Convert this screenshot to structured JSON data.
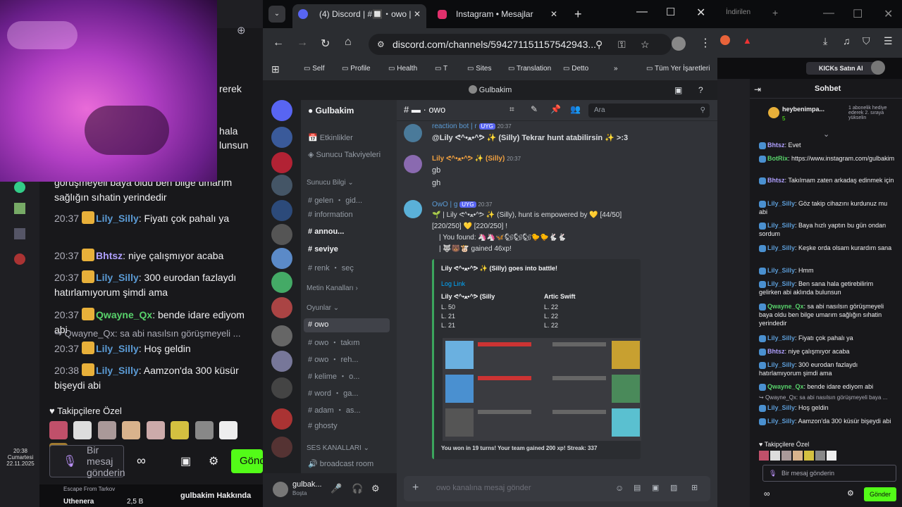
{
  "leftchat": {
    "partial1": "görüşmeyeli baya oldu ben bilge umarım sağlığın sıhatin yerindedir",
    "messages": [
      {
        "time": "20:37",
        "user": "Lily_Silly",
        "color": "#5b9bd5",
        "text": "Fiyatı çok pahalı ya"
      },
      {
        "time": "20:37",
        "user": "Bhtsz",
        "color": "#b0a0ff",
        "text": "niye çalışmıyor acaba"
      },
      {
        "time": "20:37",
        "user": "Lily_Silly",
        "color": "#5b9bd5",
        "text": "300 eurodan fazlaydı hatırlamıyorum şimdi ama"
      },
      {
        "time": "20:37",
        "user": "Qwayne_Qx",
        "color": "#58d26b",
        "text": "bende idare ediyom abi"
      },
      {
        "time": "20:37",
        "user": "Lily_Silly",
        "color": "#5b9bd5",
        "text": "Hoş geldin"
      },
      {
        "time": "20:38",
        "user": "Lily_Silly",
        "color": "#5b9bd5",
        "text": "Aamzon'da 300 küsür bişeydi abi"
      }
    ],
    "reply": "Qwayne_Qx: sa abi nasılsın görüşmeyeli ...",
    "followers": "Takipçilere Özel",
    "input_placeholder": "Bir mesaj gönderin",
    "send": "Gönd",
    "game": "Escape From Tarkov",
    "user": "Uthenera",
    "viewers": "2,5 B",
    "about": "gulbakim Hakkında",
    "clock_time": "20:38",
    "clock_day": "Cumartesi",
    "clock_date": "22.11.2025",
    "partial_left1": "rerek",
    "partial_left2": "hala",
    "partial_left3": "lunsun"
  },
  "browser": {
    "tab1": "(4) Discord | #🔲・owo | Gulbakim",
    "tab2": "Instagram • Mesajlar",
    "url": "discord.com/channels/594271151157542943...",
    "bookmarks": [
      "Self",
      "Profile",
      "Health",
      "T",
      "Sites",
      "Translation",
      "Detto",
      "Tüm Yer İşaretleri"
    ],
    "app_title": "Gulbakim"
  },
  "discord": {
    "server": "Gulbakim",
    "channel": "owo",
    "search": "Ara",
    "events": "Etkinlikler",
    "boosts": "Sunucu Takviyeleri",
    "cat_info": "Sunucu Bilgi",
    "ch_gelen": "gelen ・ gid...",
    "ch_information": "information",
    "ch_announ": "annou...",
    "ch_seviye": "seviye",
    "ch_renk": "renk ・ seç",
    "cat_text": "Metin Kanalları",
    "cat_games": "Oyunlar",
    "ch_owo": "owo",
    "ch_owo_takim": "owo ・ takım",
    "ch_owo_reh": "owo ・ reh...",
    "ch_kelime": "kelime ・ o...",
    "ch_word": "word ・ ga...",
    "ch_adam": "adam ・ as...",
    "ch_ghosty": "ghosty",
    "cat_voice": "SES KANALLARI",
    "ch_broadcast": "broadcast room",
    "me_name": "gulbak...",
    "me_status": "Boşta",
    "composer": "owo kanalına mesaj gönder",
    "msg1_user": "reaction bot | r",
    "msg1_tag": "UYG",
    "msg1_time": "20:37",
    "msg1_text": "@Lily ᕙ^•ﻌ•^ᕗ ✨ (Silly) Tekrar hunt atabilirsin ✨ >:3",
    "msg2_user": "Lily ᕙ^•ﻌ•^ᕗ ✨ (Silly)",
    "msg2_time": "20:37",
    "msg2_line1": "gb",
    "msg2_line2": "gh",
    "msg3_user": "OwO | g",
    "msg3_tag": "UYG",
    "msg3_time": "20:37",
    "msg3_line1": "🌱 | Lily ᕙ^•ﻌ•^ᕗ ✨ (Silly), hunt is empowered by 💛 [44/50]",
    "msg3_line2": "[220/250] 💛 [220/250] !",
    "msg3_line3": "| You found: 🦄🦄🦋🐿🐿🐿🐤🐤🐇🐇",
    "msg3_line4": "| 🐺🐻🐮 gained 46xp!",
    "embed_title": "Lily ᕙ^•ﻌ•^ᕗ ✨ (Silly) goes into battle!",
    "embed_link": "Log Link",
    "team1": "Lily ᕙ^•ﻌ•^ᕗ (Silly",
    "team2": "Artic Swift",
    "t1_l1": "L. 50",
    "t1_l2": "L. 21",
    "t1_l3": "L. 21",
    "t2_l1": "L. 22",
    "t2_l2": "L. 22",
    "t2_l3": "L. 22",
    "embed_footer": "You won in 19 turns! Your team gained 200 xp! Streak: 337"
  },
  "right": {
    "title": "Sohbet",
    "kicks": "KICKs Satın Al",
    "pinned_user": "heybenimpa...",
    "pinned_count": "5",
    "pinned_text": "1 abonelik hediye ederek 2. sıraya yükselin",
    "followers": "Takipçilere Özel",
    "input": "Bir mesaj gönderin",
    "send": "Gönder",
    "tab3": "İndirilen",
    "messages": [
      {
        "user": "Bhtsz",
        "color": "#b0a0ff",
        "text": "Evet"
      },
      {
        "user": "BotRix",
        "color": "#58d26b",
        "text": "https://www.instagram.com/gulbakim"
      },
      {
        "user": "Bhtsz",
        "color": "#b0a0ff",
        "text": "Takılmam zaten arkadaş edinmek için"
      },
      {
        "user": "Lily_Silly",
        "color": "#5b9bd5",
        "text": "Göz takip cihazını kurdunuz mu abi"
      },
      {
        "user": "Lily_Silly",
        "color": "#5b9bd5",
        "text": "Baya hızlı yaptın bu gün ondan sordum"
      },
      {
        "user": "Lily_Silly",
        "color": "#5b9bd5",
        "text": "Keşke orda olsam kurardım sana"
      },
      {
        "user": "Lily_Silly",
        "color": "#5b9bd5",
        "text": "Hmm"
      },
      {
        "user": "Lily_Silly",
        "color": "#5b9bd5",
        "text": "Ben sana hala getirebilirim gelirken abi aklında bulunsun"
      },
      {
        "user": "Qwayne_Qx",
        "color": "#58d26b",
        "text": "sa abi nasılsın görüşmeyeli baya oldu ben bilge umarım sağlığın sıhatin yerindedir"
      },
      {
        "user": "Lily_Silly",
        "color": "#5b9bd5",
        "text": "Fiyatı çok pahalı ya"
      },
      {
        "user": "Bhtsz",
        "color": "#b0a0ff",
        "text": "niye çalışmıyor acaba"
      },
      {
        "user": "Lily_Silly",
        "color": "#5b9bd5",
        "text": "300 eurodan fazlaydı hatırlamıyorum şimdi ama"
      },
      {
        "user": "Qwayne_Qx",
        "color": "#58d26b",
        "text": "bende idare ediyom abi"
      },
      {
        "user": "Lily_Silly",
        "color": "#5b9bd5",
        "text": "Hoş geldin"
      },
      {
        "user": "Lily_Silly",
        "color": "#5b9bd5",
        "text": "Aamzon'da 300 küsür bişeydi abi"
      }
    ],
    "reply": "Qwayne_Qx: sa abi nasılsın görüşmeyeli baya ..."
  }
}
